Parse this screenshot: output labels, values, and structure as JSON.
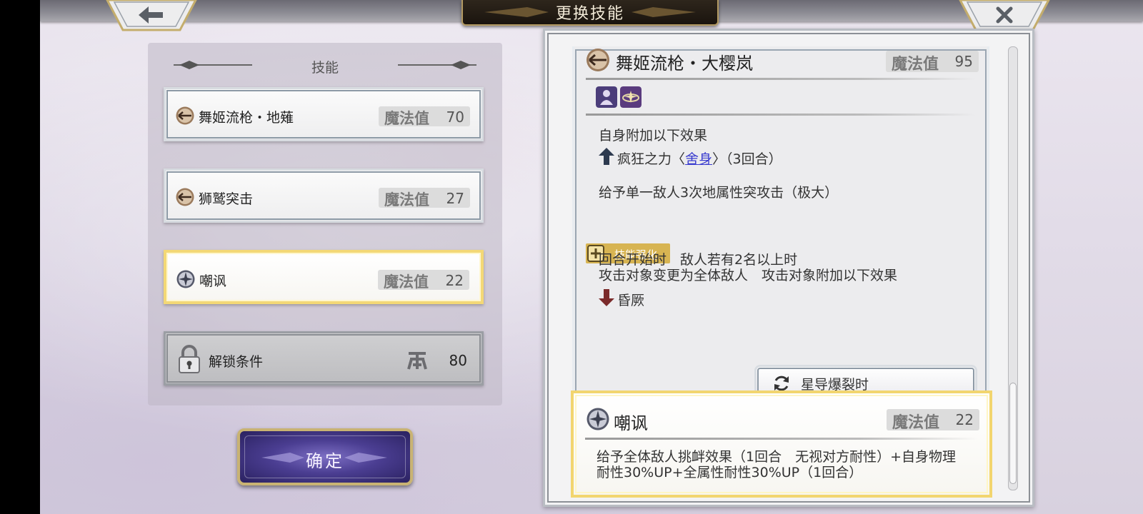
{
  "header": {
    "title": "更换技能"
  },
  "left": {
    "section_title": "技能",
    "skills": [
      {
        "name": "舞姬流枪・地薙",
        "mp_label": "魔法值",
        "mp": "70",
        "icon": "spear-icon"
      },
      {
        "name": "狮鹫突击",
        "mp_label": "魔法值",
        "mp": "27",
        "icon": "spear-icon"
      },
      {
        "name": "嘲讽",
        "mp_label": "魔法值",
        "mp": "22",
        "icon": "star-burst-icon",
        "selected": true
      }
    ],
    "locked": {
      "label": "解锁条件",
      "value": "80",
      "icon": "lock-icon"
    },
    "confirm_label": "确定"
  },
  "detail": {
    "title": "舞姬流枪・大樱岚",
    "mp_label": "魔法值",
    "mp": "95",
    "line1": "自身附加以下效果",
    "buff_prefix": "疯狂之力〈",
    "buff_link": "舍身",
    "buff_suffix": "〉（3回合）",
    "line2": "给予单一敌人3次地属性突攻击（极大）",
    "enhance_label": "技能强化",
    "line3": "回合开始时　敌人若有2名以上时",
    "line4": "攻击对象变更为全体敌人　攻击对象附加以下效果",
    "debuff": "昏厥",
    "trigger_label": "星导爆裂时"
  },
  "second": {
    "title": "嘲讽",
    "mp_label": "魔法值",
    "mp": "22",
    "desc_line1": "给予全体敌人挑衅效果（1回合　无视对方耐性）+自身物理",
    "desc_line2": "耐性30%UP+全属性耐性30%UP（1回合）"
  },
  "colors": {
    "accent_gold": "#f2d56f",
    "confirm_purple": "#4b3e92",
    "mp_box": "#dcdcdc"
  }
}
